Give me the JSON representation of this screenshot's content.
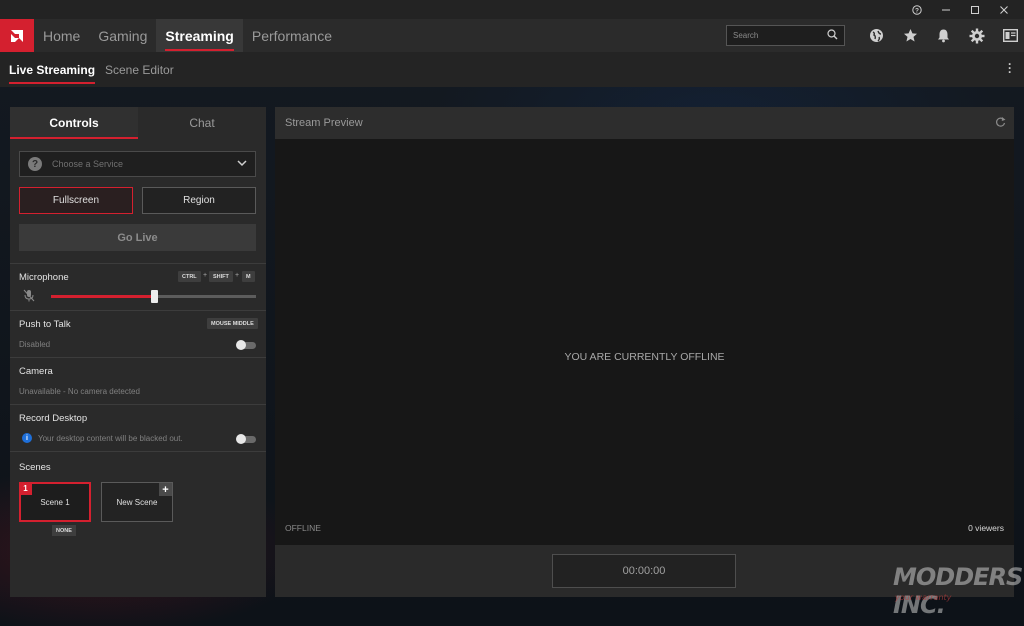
{
  "window": {
    "controls": [
      {
        "name": "help-icon",
        "glyph": "?"
      },
      {
        "name": "minimize-icon",
        "glyph": "–"
      },
      {
        "name": "maximize-icon",
        "glyph": "□"
      },
      {
        "name": "close-icon",
        "glyph": "✕"
      }
    ]
  },
  "nav": {
    "tabs": [
      {
        "label": "Home"
      },
      {
        "label": "Gaming"
      },
      {
        "label": "Streaming",
        "active": true
      },
      {
        "label": "Performance"
      }
    ],
    "search_placeholder": "Search",
    "icons": [
      "globe-icon",
      "star-icon",
      "bell-icon",
      "gear-icon",
      "layout-icon"
    ],
    "accent": "#d4202f"
  },
  "subnav": {
    "tabs": [
      {
        "label": "Live Streaming",
        "active": true
      },
      {
        "label": "Scene Editor"
      }
    ]
  },
  "controls": {
    "tabs": [
      {
        "label": "Controls",
        "active": true
      },
      {
        "label": "Chat"
      }
    ],
    "service_placeholder": "Choose a Service",
    "fullscreen_label": "Fullscreen",
    "region_label": "Region",
    "go_live_label": "Go Live",
    "microphone": {
      "title": "Microphone",
      "hotkeys": [
        "CTRL",
        "SHIFT",
        "M"
      ],
      "level": 0.5
    },
    "push_to_talk": {
      "title": "Push to Talk",
      "hotkey": "MOUSE MIDDLE",
      "status": "Disabled"
    },
    "camera": {
      "title": "Camera",
      "status": "Unavailable - No camera detected"
    },
    "record_desktop": {
      "title": "Record Desktop",
      "info": "Your desktop content will be blacked out."
    },
    "scenes": {
      "title": "Scenes",
      "items": [
        {
          "label": "Scene 1",
          "number": "1",
          "badge": "NONE"
        },
        {
          "label": "New Scene"
        }
      ]
    }
  },
  "preview": {
    "title": "Stream Preview",
    "message": "YOU ARE CURRENTLY OFFLINE",
    "status": "OFFLINE",
    "viewers": "0 viewers",
    "timer": "00:00:00"
  },
  "watermark": {
    "brand": "MODDERS INC.",
    "tagline": "your warranty"
  }
}
